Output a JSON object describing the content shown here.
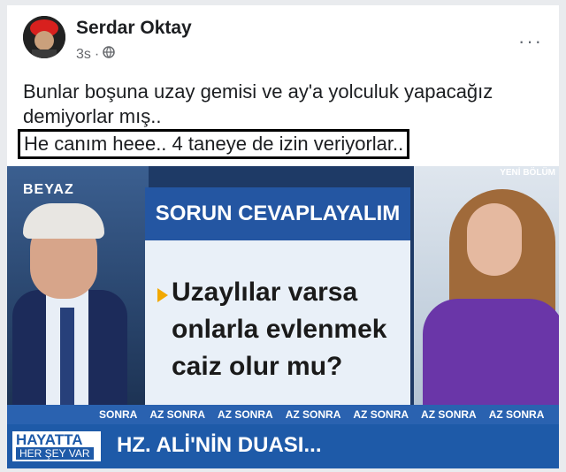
{
  "post": {
    "author": "Serdar Oktay",
    "time": "3s",
    "more_label": "···",
    "line1": "Bunlar boşuna uzay gemisi ve ay'a yolculuk yapacağız",
    "line2": "demiyorlar mış..",
    "line3": "He canım heee.. 4 taneye de izin veriyorlar.."
  },
  "tv": {
    "channel": "BEYAZ",
    "corner": "YENİ BÖLÜM",
    "panel_title": "SORUN CEVAPLAYALIM",
    "question_l1": "Uzaylılar varsa",
    "question_l2": "onlarla evlenmek",
    "question_l3": "caiz olur mu?",
    "ticker": [
      "SONRA",
      "AZ SONRA",
      "AZ SONRA",
      "AZ SONRA",
      "AZ SONRA",
      "AZ SONRA",
      "AZ SONRA"
    ],
    "show_l1": "HAYATTA",
    "show_l2": "HER ŞEY VAR",
    "headline": "HZ. ALİ'NİN DUASI..."
  },
  "icons": {
    "privacy": "globe-icon",
    "more": "more-options-icon"
  }
}
